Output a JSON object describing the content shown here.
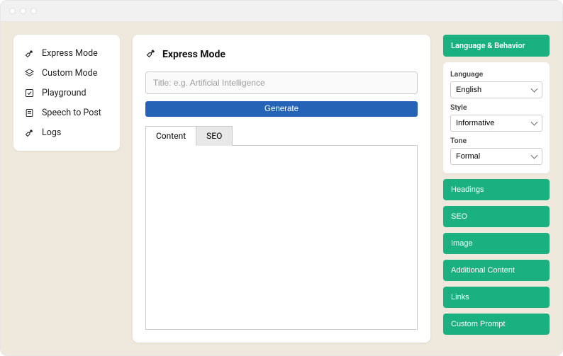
{
  "sidebar": {
    "items": [
      {
        "label": "Express Mode",
        "icon": "wrench-icon"
      },
      {
        "label": "Custom Mode",
        "icon": "layers-icon"
      },
      {
        "label": "Playground",
        "icon": "checksquare-icon"
      },
      {
        "label": "Speech to Post",
        "icon": "note-icon"
      },
      {
        "label": "Logs",
        "icon": "wrench-icon"
      }
    ]
  },
  "main": {
    "title": "Express Mode",
    "title_placeholder": "Title: e.g. Artificial Intelligence",
    "generate_label": "Generate",
    "tabs": [
      {
        "label": "Content",
        "active": true
      },
      {
        "label": "SEO",
        "active": false
      }
    ],
    "content_value": ""
  },
  "right": {
    "panel_header": "Language & Behavior",
    "fields": {
      "language": {
        "label": "Language",
        "value": "English"
      },
      "style": {
        "label": "Style",
        "value": "Informative"
      },
      "tone": {
        "label": "Tone",
        "value": "Formal"
      }
    },
    "buttons": [
      "Headings",
      "SEO",
      "Image",
      "Additional Content",
      "Links",
      "Custom Prompt"
    ]
  },
  "colors": {
    "accent_green": "#1bb07f",
    "accent_blue": "#2563b6",
    "bg": "#efe8dc"
  }
}
